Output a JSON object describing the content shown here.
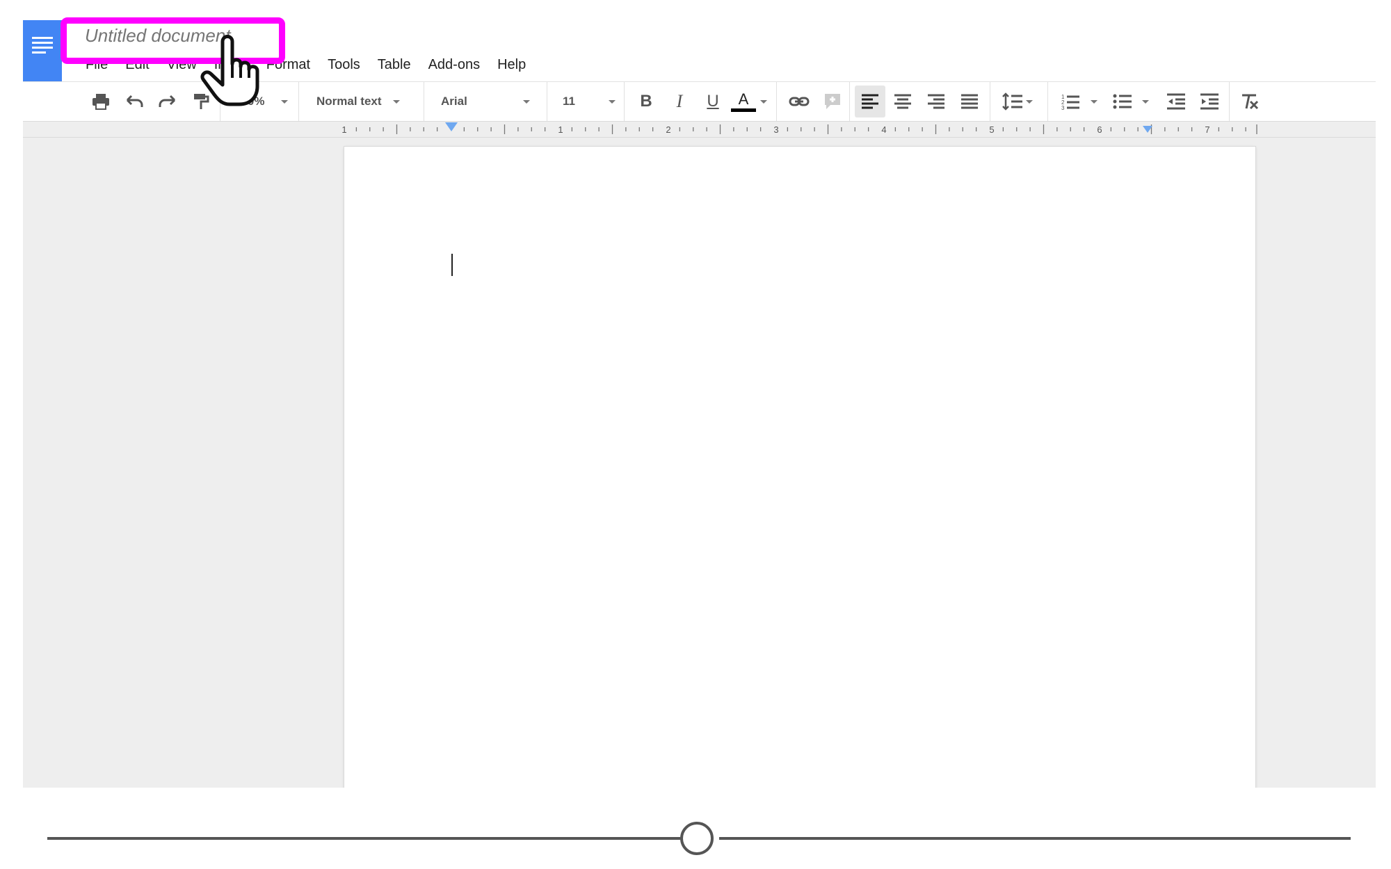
{
  "document": {
    "title": "Untitled document"
  },
  "menu": [
    "File",
    "Edit",
    "View",
    "Insert",
    "Format",
    "Tools",
    "Table",
    "Add-ons",
    "Help"
  ],
  "toolbar": {
    "zoom": "100%",
    "style": "Normal text",
    "font": "Arial",
    "font_size": "11",
    "bold": "B",
    "italic": "I",
    "underline": "U",
    "text_color": "A"
  },
  "ruler": {
    "labels": [
      "1",
      "1",
      "2",
      "3",
      "4",
      "5",
      "6",
      "7"
    ]
  },
  "colors": {
    "highlight": "#ff00ff",
    "logo": "#4285f4",
    "ruler_marker": "#6fa8f0"
  },
  "timeline": {
    "position": 0.5
  }
}
